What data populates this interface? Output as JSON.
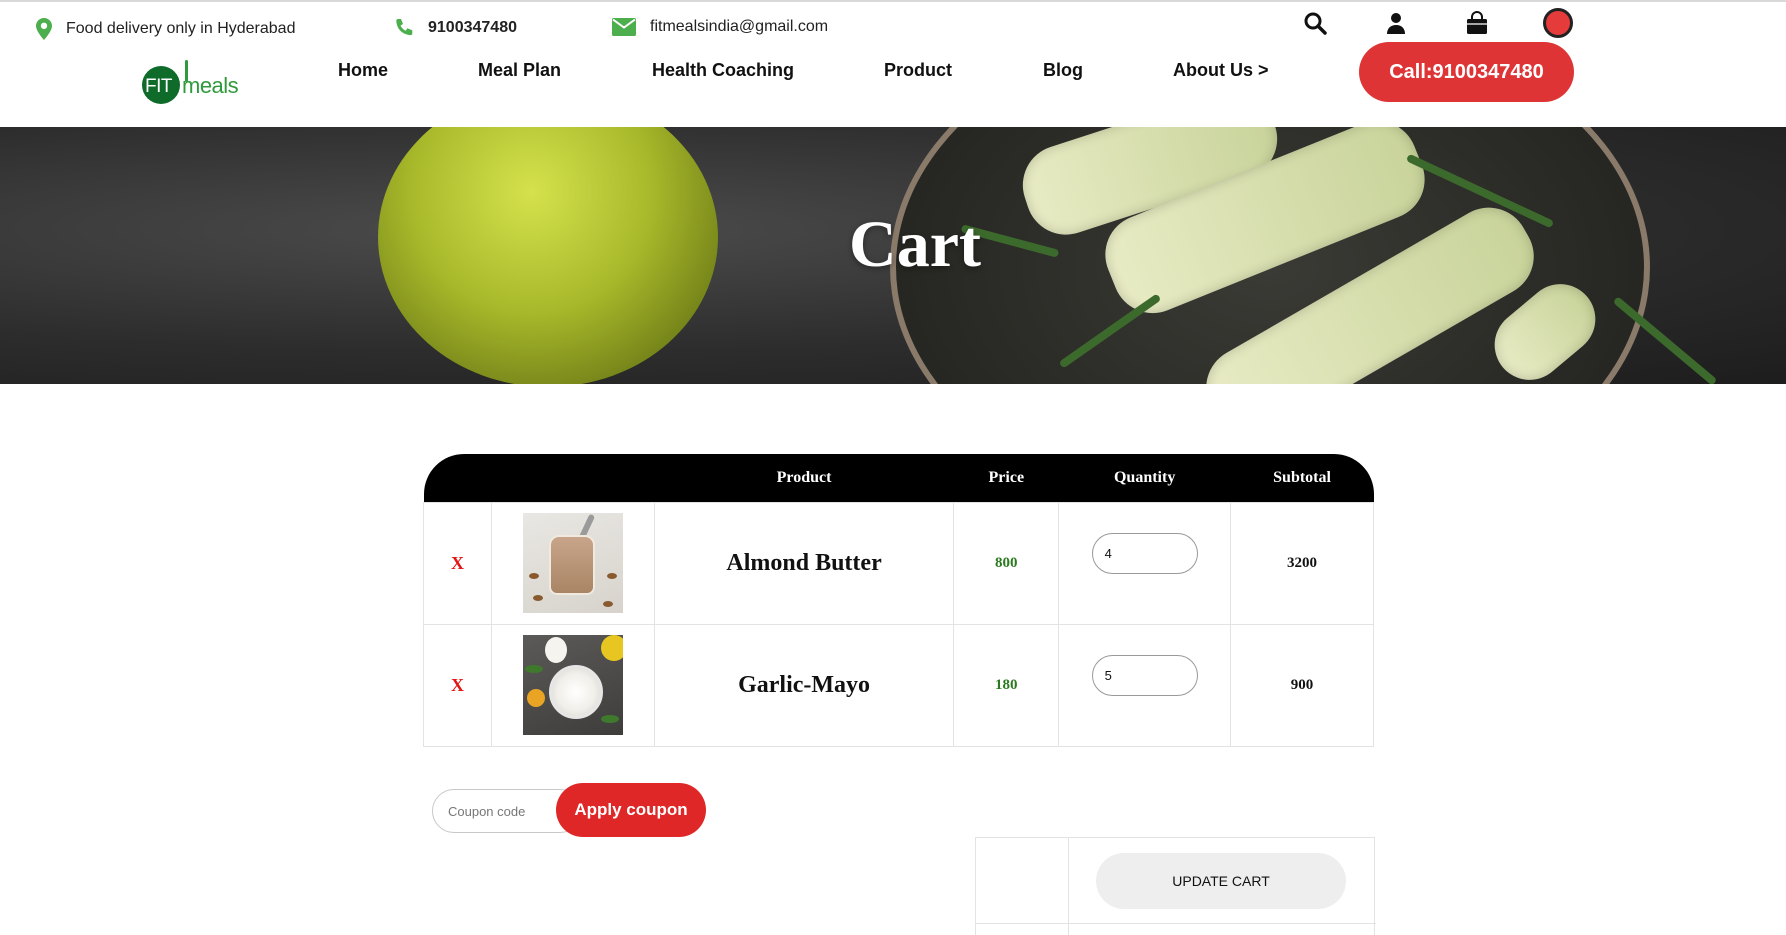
{
  "topbar": {
    "address": "Food delivery only in Hyderabad",
    "phone": "9100347480",
    "email": "fitmealsindia@gmail.com",
    "icons": [
      "search-icon",
      "user-icon",
      "shopping-bag-icon",
      "avatar-icon"
    ]
  },
  "logo": {
    "part1": "FIT",
    "part2": "meals"
  },
  "nav": {
    "items": [
      "Home",
      "Meal Plan",
      "Health Coaching",
      "Product",
      "Blog",
      "About Us >"
    ],
    "call_label": "Call:9100347480"
  },
  "hero": {
    "title": "Cart"
  },
  "cart": {
    "headers": [
      "",
      "",
      "Product",
      "Price",
      "Quantity",
      "Subtotal"
    ],
    "rows": [
      {
        "remove": "X",
        "name": "Almond Butter",
        "price": "800",
        "quantity": "4",
        "subtotal": "3200"
      },
      {
        "remove": "X",
        "name": "Garlic-Mayo",
        "price": "180",
        "quantity": "5",
        "subtotal": "900"
      }
    ]
  },
  "coupon": {
    "placeholder": "Coupon code",
    "apply_label": "Apply coupon"
  },
  "update": {
    "label": "UPDATE CART"
  },
  "colors": {
    "accent": "#df3436",
    "price_green": "#2a7a1f",
    "brand_green": "#2f9a3c"
  }
}
